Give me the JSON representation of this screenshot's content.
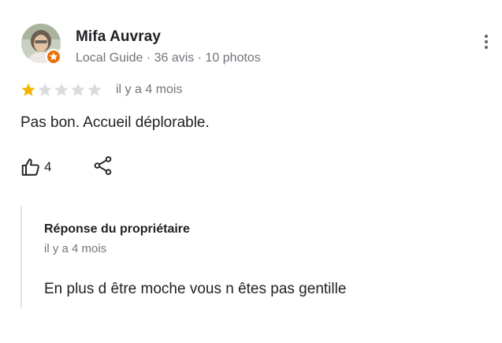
{
  "review": {
    "author": {
      "name": "Mifa Auvray",
      "meta": "Local Guide · 36 avis · 10 photos",
      "avatar_icon": "user-photo-avatar",
      "badge_icon": "local-guide-star-badge",
      "badge_color": "#e8710a"
    },
    "rating": {
      "value": 1,
      "max": 5,
      "filled_color": "#f4b400",
      "empty_color": "#dadce0"
    },
    "time": "il y a 4 mois",
    "text": "Pas bon. Accueil déplorable.",
    "likes": "4",
    "actions": {
      "like_icon": "thumbs-up-icon",
      "share_icon": "share-icon",
      "more_icon": "more-vert-icon"
    }
  },
  "owner_response": {
    "label": "Réponse du propriétaire",
    "time": "il y a 4 mois",
    "text": "En plus d être moche vous n êtes pas gentille"
  }
}
